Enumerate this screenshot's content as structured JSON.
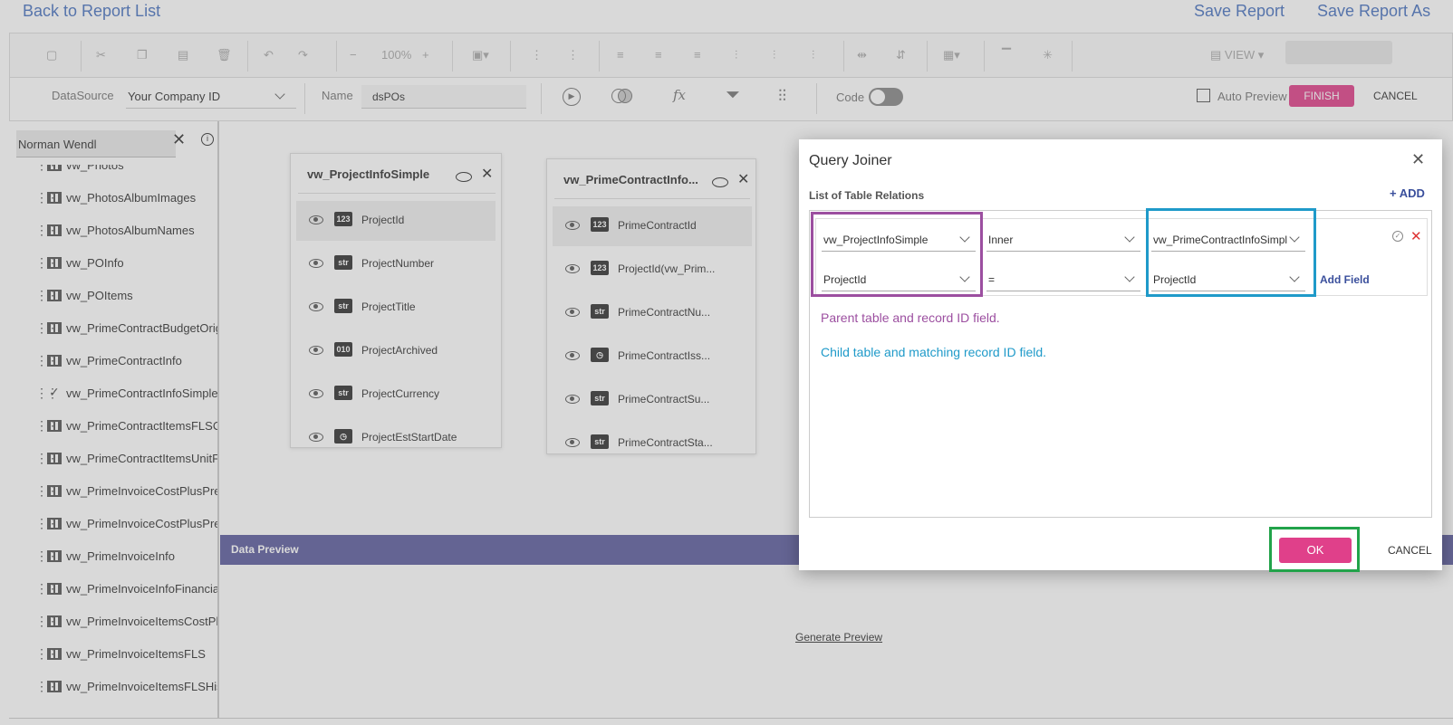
{
  "header": {
    "back": "Back to Report List",
    "save": "Save Report",
    "save_as": "Save Report As"
  },
  "toolbar": {
    "zoom": "100%",
    "view": "VIEW"
  },
  "datasource": {
    "label": "DataSource",
    "value": "Your Company ID",
    "name_label": "Name",
    "name_value": "dsPOs",
    "code_label": "Code",
    "auto_preview": "Auto Preview",
    "finish": "FINISH",
    "cancel": "CANCEL"
  },
  "sidebar": {
    "search_value": "Norman Wendl",
    "items": [
      {
        "label": "vw_Photos"
      },
      {
        "label": "vw_PhotosAlbumImages"
      },
      {
        "label": "vw_PhotosAlbumNames"
      },
      {
        "label": "vw_POInfo"
      },
      {
        "label": "vw_POItems"
      },
      {
        "label": "vw_PrimeContractBudgetOrig"
      },
      {
        "label": "vw_PrimeContractInfo"
      },
      {
        "label": "vw_PrimeContractInfoSimple"
      },
      {
        "label": "vw_PrimeContractItemsFLSC"
      },
      {
        "label": "vw_PrimeContractItemsUnitF"
      },
      {
        "label": "vw_PrimeInvoiceCostPlusPre"
      },
      {
        "label": "vw_PrimeInvoiceCostPlusPre"
      },
      {
        "label": "vw_PrimeInvoiceInfo"
      },
      {
        "label": "vw_PrimeInvoiceInfoFinancia"
      },
      {
        "label": "vw_PrimeInvoiceItemsCostPl"
      },
      {
        "label": "vw_PrimeInvoiceItemsFLS"
      },
      {
        "label": "vw_PrimeInvoiceItemsFLSHis"
      }
    ]
  },
  "card1": {
    "title": "vw_ProjectInfoSimple",
    "fields": [
      {
        "badge": "123",
        "name": "ProjectId"
      },
      {
        "badge": "str",
        "name": "ProjectNumber"
      },
      {
        "badge": "str",
        "name": "ProjectTitle"
      },
      {
        "badge": "010",
        "name": "ProjectArchived"
      },
      {
        "badge": "str",
        "name": "ProjectCurrency"
      },
      {
        "badge": "◷",
        "name": "ProjectEstStartDate"
      }
    ]
  },
  "card2": {
    "title": "vw_PrimeContractInfo...",
    "fields": [
      {
        "badge": "123",
        "name": "PrimeContractId"
      },
      {
        "badge": "123",
        "name": "ProjectId(vw_Prim..."
      },
      {
        "badge": "str",
        "name": "PrimeContractNu..."
      },
      {
        "badge": "◷",
        "name": "PrimeContractIss..."
      },
      {
        "badge": "str",
        "name": "PrimeContractSu..."
      },
      {
        "badge": "str",
        "name": "PrimeContractSta..."
      }
    ]
  },
  "preview": {
    "title": "Data Preview",
    "generate": "Generate Preview"
  },
  "dialog": {
    "title": "Query Joiner",
    "list_label": "List of Table Relations",
    "add": "ADD",
    "parent_table": "vw_ProjectInfoSimple",
    "join_type": "Inner",
    "child_table": "vw_PrimeContractInfoSimple",
    "parent_field": "ProjectId",
    "operator": "=",
    "child_field": "ProjectId",
    "add_field": "Add Field",
    "note_parent": "Parent table and record ID field.",
    "note_child": "Child table and matching record ID field.",
    "ok": "OK",
    "cancel": "CANCEL"
  },
  "colors": {
    "parent_highlight": "#9c4fa0",
    "child_highlight": "#1f9ac9",
    "ok_highlight": "#22a34a",
    "accent": "#e0408a",
    "preview_bar": "#5e5e9e"
  }
}
